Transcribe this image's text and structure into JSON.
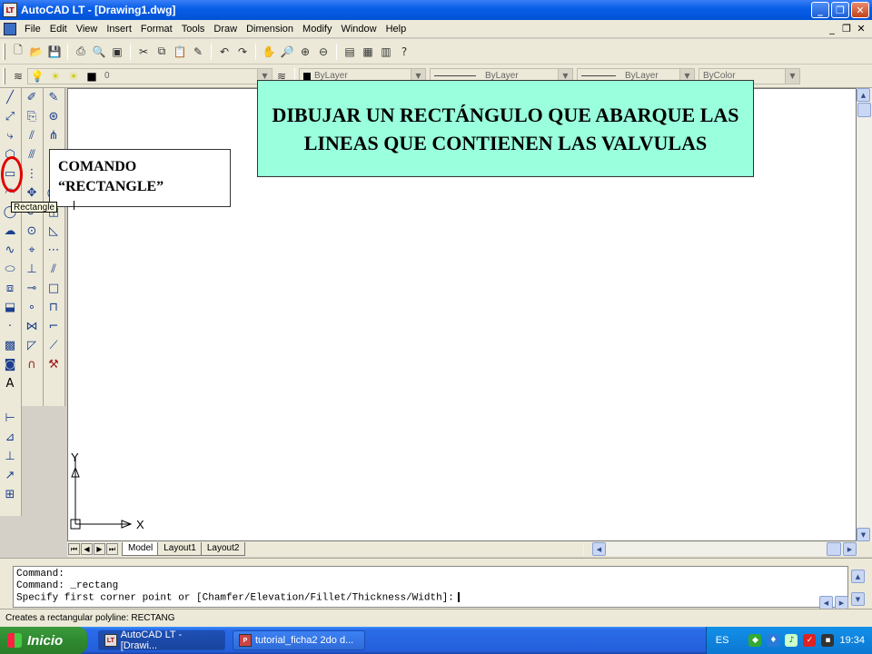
{
  "window": {
    "title": "AutoCAD LT - [Drawing1.dwg]",
    "app_icon": "LT",
    "buttons": [
      "minimize",
      "maximize",
      "close"
    ]
  },
  "menubar": {
    "items": [
      "File",
      "Edit",
      "View",
      "Insert",
      "Format",
      "Tools",
      "Draw",
      "Dimension",
      "Modify",
      "Window",
      "Help"
    ]
  },
  "toolbar": {
    "layer_value": "0",
    "color_value": "ByLayer",
    "linetype_value": "ByLayer",
    "lineweight_value": "ByLayer",
    "plotstyle_value": "ByColor"
  },
  "tooltip": {
    "text": "Rectangle"
  },
  "annotation": {
    "main_note": "DIBUJAR UN  RECTÁNGULO QUE ABARQUE LAS LINEAS QUE CONTIENEN LAS VALVULAS",
    "command_note_line1": "COMANDO",
    "command_note_line2": "“RECTANGLE”"
  },
  "ucs": {
    "x_label": "X",
    "y_label": "Y"
  },
  "tabs": [
    {
      "label": "Model",
      "active": true
    },
    {
      "label": "Layout1",
      "active": false
    },
    {
      "label": "Layout2",
      "active": false
    }
  ],
  "command_window": {
    "lines": [
      "Command:",
      "Command: _rectang",
      "Specify first corner point or [Chamfer/Elevation/Fillet/Thickness/Width]:"
    ]
  },
  "statusbar": {
    "text": "Creates a rectangular polyline:  RECTANG"
  },
  "taskbar": {
    "start_label": "Inicio",
    "buttons": [
      "AutoCAD LT - [Drawi...",
      "tutorial_ficha2 2do d..."
    ],
    "language": "ES",
    "clock": "19:34"
  },
  "colors": {
    "note_bg": "#99ffdd",
    "highlight": "#e10000",
    "titlebar": "#0a5fe8"
  }
}
